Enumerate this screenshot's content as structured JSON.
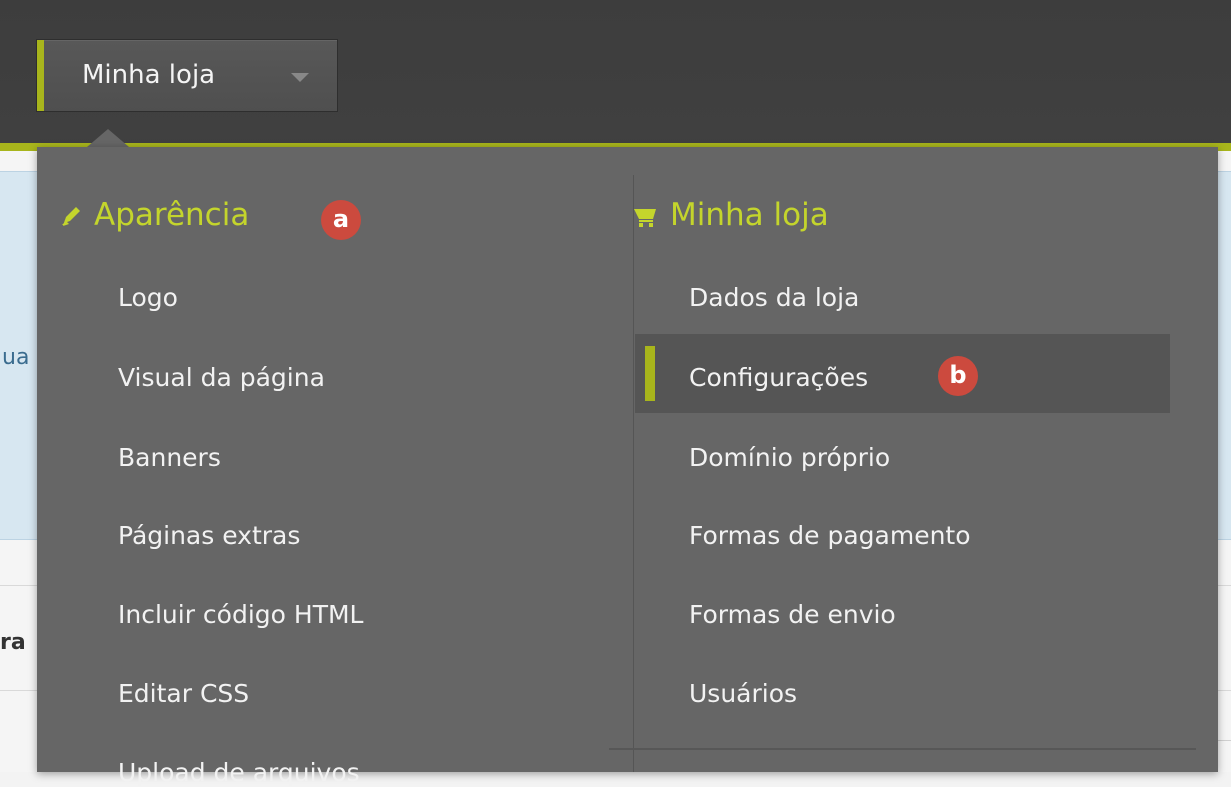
{
  "header": {
    "store_button_label": "Minha loja"
  },
  "background": {
    "info_text_fragment": "ua",
    "bold_fragment": "ra"
  },
  "dropdown": {
    "left_section": {
      "title": "Aparência",
      "icon": "pencil-icon",
      "badge": "a",
      "items": [
        {
          "label": "Logo"
        },
        {
          "label": "Visual da página"
        },
        {
          "label": "Banners"
        },
        {
          "label": "Páginas extras"
        },
        {
          "label": "Incluir código HTML"
        },
        {
          "label": "Editar CSS"
        },
        {
          "label": "Upload de arquivos"
        }
      ]
    },
    "right_section": {
      "title": "Minha loja",
      "icon": "cart-icon",
      "badge": "b",
      "selected_item": "Configurações",
      "items": [
        {
          "label": "Dados da loja"
        },
        {
          "label": "Configurações"
        },
        {
          "label": "Domínio próprio"
        },
        {
          "label": "Formas de pagamento"
        },
        {
          "label": "Formas de envio"
        },
        {
          "label": "Usuários"
        }
      ]
    }
  },
  "colors": {
    "accent": "#a8b51c",
    "section_title": "#c4d52c",
    "dropdown_bg": "#666666",
    "badge": "#cc4a3e"
  }
}
